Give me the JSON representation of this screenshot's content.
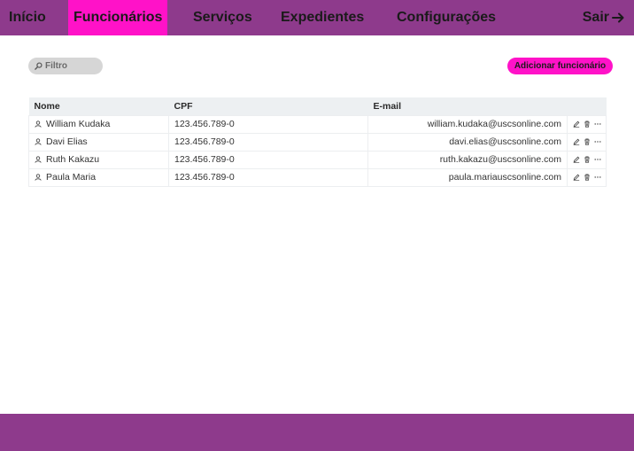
{
  "nav": {
    "items": [
      {
        "label": "Início"
      },
      {
        "label": "Funcionários"
      },
      {
        "label": "Serviços"
      },
      {
        "label": "Expedientes"
      },
      {
        "label": "Configurações"
      }
    ],
    "logout_label": "Sair"
  },
  "toolbar": {
    "filter_placeholder": "Filtro",
    "add_label": "Adicionar funcionário"
  },
  "table": {
    "headers": [
      "Nome",
      "CPF",
      "E-mail"
    ],
    "rows": [
      {
        "name": "William Kudaka",
        "cpf": "123.456.789-0",
        "email": "william.kudaka@uscsonline.com"
      },
      {
        "name": "Davi Elias",
        "cpf": "123.456.789-0",
        "email": "davi.elias@uscsonline.com"
      },
      {
        "name": "Ruth Kakazu",
        "cpf": "123.456.789-0",
        "email": "ruth.kakazu@uscsonline.com"
      },
      {
        "name": "Paula Maria",
        "cpf": "123.456.789-0",
        "email": "paula.mariauscsonline.com"
      }
    ]
  },
  "colors": {
    "header_bg": "#8e3a8c",
    "accent": "#ff12c8",
    "table_header_bg": "#edf0f2",
    "filter_bg": "#d6d6d6"
  },
  "icons": {
    "row_user": "user-icon",
    "row_actions": [
      "edit-icon",
      "trash-icon",
      "more-icon"
    ],
    "filter": "search-icon",
    "logout": "arrow-right-icon"
  }
}
